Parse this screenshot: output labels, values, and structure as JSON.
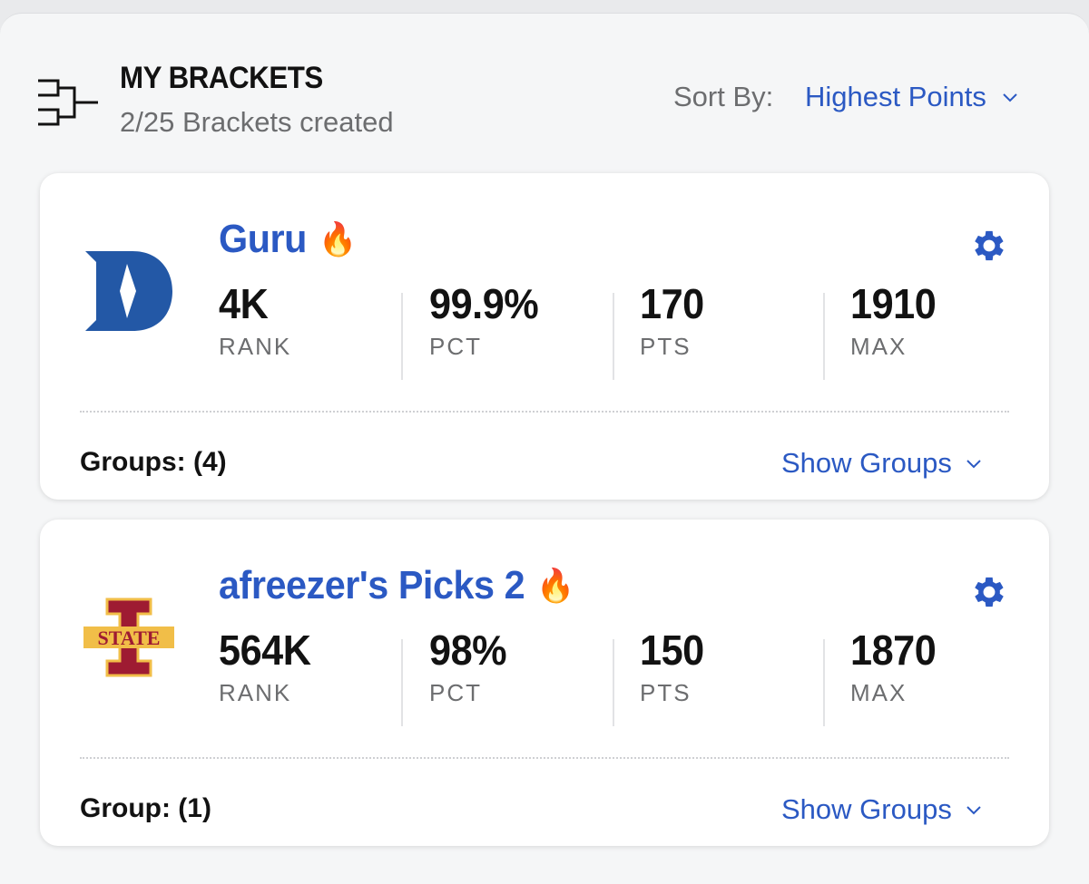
{
  "header": {
    "title": "MY BRACKETS",
    "subtitle": "2/25 Brackets created",
    "sort_label": "Sort By:",
    "sort_value": "Highest Points"
  },
  "brackets": [
    {
      "name": "Guru",
      "emoji": "🔥",
      "team_logo": "duke-d-logo",
      "stats": [
        {
          "value": "4K",
          "label": "RANK"
        },
        {
          "value": "99.9%",
          "label": "PCT"
        },
        {
          "value": "170",
          "label": "PTS"
        },
        {
          "value": "1910",
          "label": "MAX"
        }
      ],
      "groups_text": "Groups: (4)",
      "show_groups": "Show Groups"
    },
    {
      "name": "afreezer's Picks 2",
      "emoji": "🔥",
      "team_logo": "iowa-state-logo",
      "stats": [
        {
          "value": "564K",
          "label": "RANK"
        },
        {
          "value": "98%",
          "label": "PCT"
        },
        {
          "value": "150",
          "label": "PTS"
        },
        {
          "value": "1870",
          "label": "MAX"
        }
      ],
      "groups_text": "Group: (1)",
      "show_groups": "Show Groups"
    }
  ],
  "colors": {
    "accent": "#2b59c3",
    "text": "#121212",
    "muted": "#6c6d6f",
    "duke_blue": "#2358a6",
    "isu_cardinal": "#9e1b32",
    "isu_gold": "#f1be48"
  },
  "logo_text": {
    "iowa_state_word": "STATE"
  }
}
